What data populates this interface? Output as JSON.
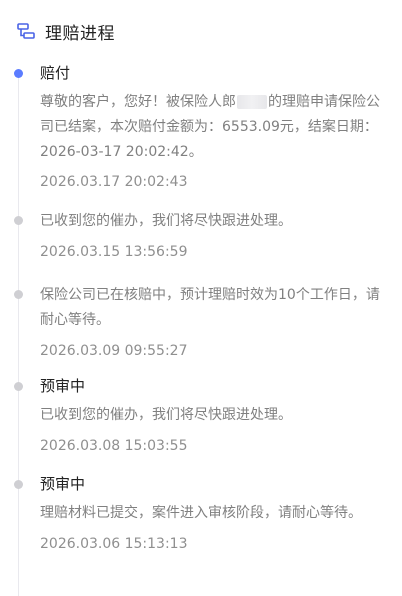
{
  "header": {
    "title": "理赔进程",
    "icon": "claim-progress-icon"
  },
  "colors": {
    "active_dot": "#5b7cff",
    "inactive_dot": "#cfcfd3",
    "line": "#e9e9ee",
    "secondary_text": "#808080"
  },
  "timeline": [
    {
      "status": "赔付",
      "text_part1": "尊敬的客户，您好！被保险人郎",
      "text_part2": "的理赔申请保险公司已结案，本次赔付金额为：6553.09元，结案日期：2026-03-17 20:02:42。",
      "time": "2026.03.17 20:02:43"
    },
    {
      "text": "已收到您的催办，我们将尽快跟进处理。",
      "time": "2026.03.15 13:56:59"
    },
    {
      "text": "保险公司已在核赔中，预计理赔时效为10个工作日，请耐心等待。",
      "time": "2026.03.09 09:55:27"
    },
    {
      "status": "预审中",
      "text": "已收到您的催办，我们将尽快跟进处理。",
      "time": "2026.03.08 15:03:55"
    },
    {
      "status": "预审中",
      "text": "理赔材料已提交，案件进入审核阶段，请耐心等待。",
      "time": "2026.03.06 15:13:13"
    }
  ]
}
